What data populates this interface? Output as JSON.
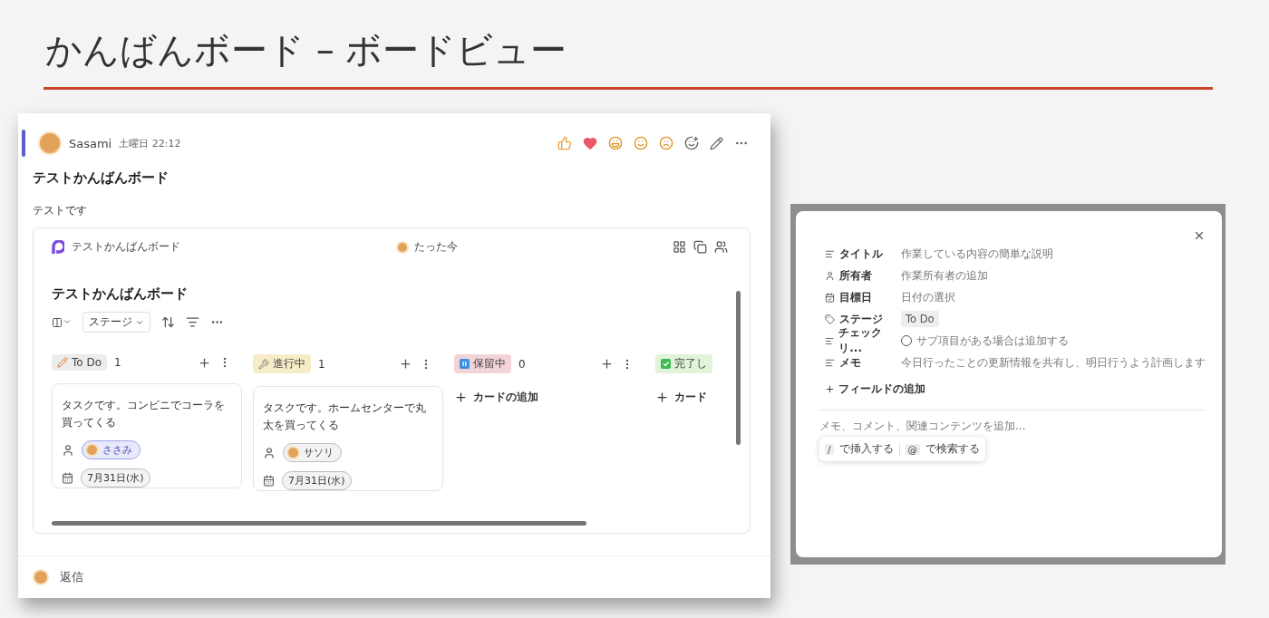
{
  "slide_title": "かんばんボード – ボードビュー",
  "post": {
    "author": "Sasami",
    "time": "土曜日 22:12",
    "subject": "テストかんばんボード",
    "body": "テストです",
    "loop": {
      "app_name": "テストかんばんボード",
      "updated": "たった今",
      "board_title": "テストかんばんボード",
      "group_by": "ステージ",
      "columns": [
        {
          "label": "To Do",
          "count": "1",
          "color": "#ececec",
          "kind": "todo",
          "cards": [
            {
              "text": "タスクです。コンビニでコーラを買ってくる",
              "owner": "ささみ",
              "owner_selected": true,
              "date": "7月31日(水)"
            }
          ]
        },
        {
          "label": "進行中",
          "count": "1",
          "color": "#f7ecc8",
          "kind": "progress",
          "cards": [
            {
              "text": "タスクです。ホームセンターで丸太を買ってくる",
              "owner": "サソリ",
              "owner_selected": false,
              "date": "7月31日(水)"
            }
          ]
        },
        {
          "label": "保留中",
          "count": "0",
          "color": "#f2d3d8",
          "kind": "hold",
          "add_card": "カードの追加"
        },
        {
          "label": "完了し",
          "color": "#e1f3d8",
          "kind": "done",
          "add_card": "カード"
        }
      ]
    },
    "reply": "返信"
  },
  "task_dialog": {
    "fields": [
      {
        "label": "タイトル",
        "kind": "text",
        "value": "作業している内容の簡単な説明"
      },
      {
        "label": "所有者",
        "kind": "person",
        "value": "作業所有者の追加"
      },
      {
        "label": "目標日",
        "kind": "date",
        "value": "日付の選択"
      },
      {
        "label": "ステージ",
        "kind": "tag",
        "value": "To Do"
      },
      {
        "label": "チェックリ...",
        "kind": "checklist",
        "value": "サブ項目がある場合は追加する",
        "checked": false
      },
      {
        "label": "メモ",
        "kind": "text",
        "value": "今日行ったことの更新情報を共有し、明日行うよう計画します"
      }
    ],
    "add_field": "フィールドの追加",
    "notes_placeholder": "メモ、コメント、関連コンテンツを追加...",
    "hints": [
      {
        "key": "/",
        "text": "で挿入する"
      },
      {
        "key": "@",
        "text": "で検索する"
      }
    ]
  }
}
